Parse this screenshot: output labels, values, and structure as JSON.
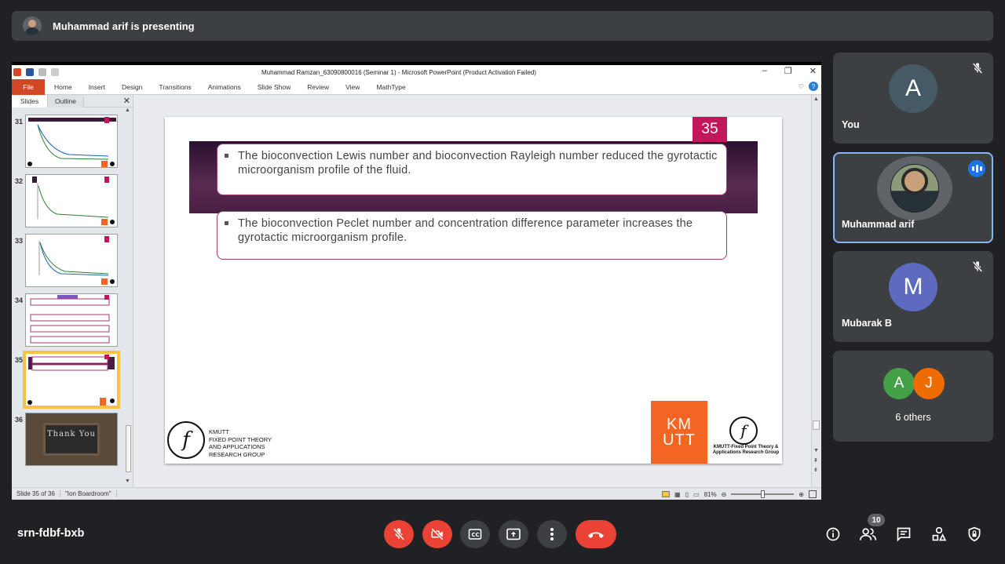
{
  "banner": {
    "text": "Muhammad arif is presenting"
  },
  "ppt": {
    "window_title": "Muhammad Ramzan_63090800016 (Seminar 1)  -  Microsoft PowerPoint (Product Activation Failed)",
    "ribbon_tabs": [
      "File",
      "Home",
      "Insert",
      "Design",
      "Transitions",
      "Animations",
      "Slide Show",
      "Review",
      "View",
      "MathType"
    ],
    "panel_tabs": [
      "Slides",
      "Outline"
    ],
    "thumbnails": [
      {
        "num": "31"
      },
      {
        "num": "32"
      },
      {
        "num": "33"
      },
      {
        "num": "34"
      },
      {
        "num": "35"
      },
      {
        "num": "36"
      }
    ],
    "thumb36_text": "Thank You",
    "slide": {
      "number": "35",
      "bullet1": "The bioconvection Lewis number and bioconvection Rayleigh number reduced the gyrotactic microorganism profile of the fluid.",
      "bullet2": "The bioconvection Peclet number and concentration difference parameter increases the gyrotactic microorganism profile.",
      "logo_left_text": "KMUTT\nFIXED POINT THEORY\nAND APPLICATIONS\nRESEARCH GROUP",
      "kmutt_line1": "KM",
      "kmutt_line2": "UTT",
      "logo_right_text": "KMUTT-Fixed Point Theory & Applications Research Group"
    },
    "status": {
      "slide_pos": "Slide 35 of 36",
      "theme": "\"Ion Boardroom\"",
      "zoom": "81%",
      "zoom_fraction": 0.5
    }
  },
  "participants": [
    {
      "initial": "A",
      "name": "You",
      "color": "#455a64",
      "muted": true
    },
    {
      "name": "Muhammad arif",
      "speaking": true
    },
    {
      "initial": "M",
      "name": "Mubarak B",
      "color": "#5c6bc0",
      "muted": true
    }
  ],
  "others": {
    "a1": "A",
    "a1_color": "#43a047",
    "a2": "J",
    "a2_color": "#ef6c00",
    "label": "6 others"
  },
  "meeting": {
    "code": "srn-fdbf-bxb",
    "participant_count": "10"
  },
  "icons": [
    "mic-off-icon",
    "video-off-icon",
    "captions-icon",
    "present-icon",
    "more-icon",
    "end-call-icon",
    "info-icon",
    "people-icon",
    "chat-icon",
    "activities-icon",
    "host-controls-icon"
  ]
}
